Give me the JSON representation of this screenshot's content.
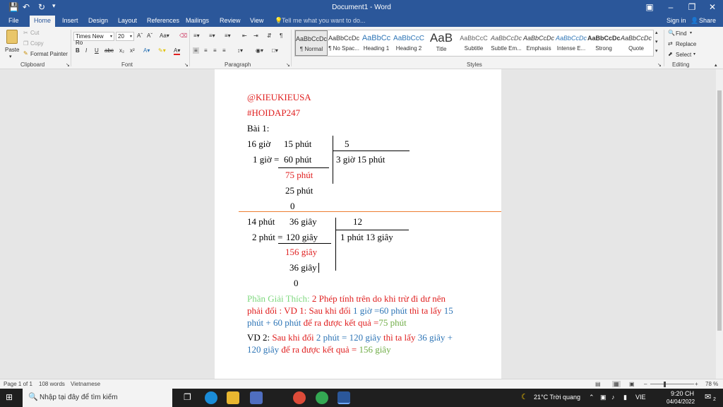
{
  "window": {
    "title": "Document1 - Word",
    "sign_in": "Sign in",
    "share": "Share"
  },
  "tabs": [
    {
      "label": "File"
    },
    {
      "label": "Home"
    },
    {
      "label": "Insert"
    },
    {
      "label": "Design"
    },
    {
      "label": "Layout"
    },
    {
      "label": "References"
    },
    {
      "label": "Mailings"
    },
    {
      "label": "Review"
    },
    {
      "label": "View"
    }
  ],
  "tell_me": "Tell me what you want to do...",
  "clipboard": {
    "paste": "Paste",
    "cut": "Cut",
    "copy": "Copy",
    "format_painter": "Format Painter",
    "label": "Clipboard"
  },
  "font": {
    "name": "Times New Ro",
    "size": "20",
    "label": "Font"
  },
  "paragraph": {
    "label": "Paragraph"
  },
  "styles": {
    "label": "Styles",
    "items": [
      {
        "sample": "AaBbCcDc",
        "name": "¶ Normal"
      },
      {
        "sample": "AaBbCcDc",
        "name": "¶ No Spac..."
      },
      {
        "sample": "AaBbCc",
        "name": "Heading 1"
      },
      {
        "sample": "AaBbCcC",
        "name": "Heading 2"
      },
      {
        "sample": "AaB",
        "name": "Title"
      },
      {
        "sample": "AaBbCcC",
        "name": "Subtitle"
      },
      {
        "sample": "AaBbCcDc",
        "name": "Subtle Em..."
      },
      {
        "sample": "AaBbCcDc",
        "name": "Emphasis"
      },
      {
        "sample": "AaBbCcDc",
        "name": "Intense E..."
      },
      {
        "sample": "AaBbCcDc",
        "name": "Strong"
      },
      {
        "sample": "AaBbCcDc",
        "name": "Quote"
      }
    ]
  },
  "editing": {
    "find": "Find",
    "replace": "Replace",
    "select": "Select",
    "label": "Editing"
  },
  "document": {
    "line1": "@KIEUKIEUSA",
    "line2": "#HOIDAP247",
    "line3": "Bài 1:",
    "p1": {
      "a": "16 giờ",
      "b": "15 phút",
      "divisor": "5",
      "c": "1 giờ =",
      "d": "60 phút",
      "quotient": "3 giờ 15 phút",
      "e": "75 phút",
      "f": "25 phút",
      "g": "0"
    },
    "p2": {
      "a": "14 phút",
      "b": "36 giây",
      "divisor": "12",
      "c": "2 phút =",
      "d": "120 giây",
      "quotient": "1 phút 13 giây",
      "e": "156 giây",
      "f": "36 giây",
      "g": "0"
    },
    "explain": {
      "r1a": "Phần Giải Thích:",
      "r1b": "2 Phép tính trên do khi trừ đi dư nên",
      "r2a": "phải đổi : VD 1:",
      "r2b": "Sau khi đổi",
      "r2c": "1 giờ =60 phút",
      "r2d": "thì ta lấy",
      "r2e": "15",
      "r3a": "phút + 60 phút",
      "r3b": "để ra được kết quả =",
      "r3c": "75 phút",
      "r4a": "VD 2:",
      "r4b": "Sau khi đổi",
      "r4c": "2 phút = 120 giây",
      "r4d": "thì ta lấy",
      "r4e": "36 giây +",
      "r5a": "120 giây",
      "r5b": "để ra được kết quả =",
      "r5c": "156 giây"
    }
  },
  "status": {
    "page": "Page 1 of 1",
    "words": "108 words",
    "language": "Vietnamese",
    "zoom": "78 %"
  },
  "taskbar": {
    "search_placeholder": "Nhập tại đây để tìm kiếm",
    "weather": "21°C Trời quang",
    "lang": "VIE",
    "time": "9:20 CH",
    "date": "04/04/2022",
    "notifications": "2"
  },
  "colors": {
    "word_blue": "#2b579a",
    "red": "#e02020",
    "blue": "#2e75b6",
    "green": "#70ad47",
    "orange_rule": "#ed7d31"
  }
}
